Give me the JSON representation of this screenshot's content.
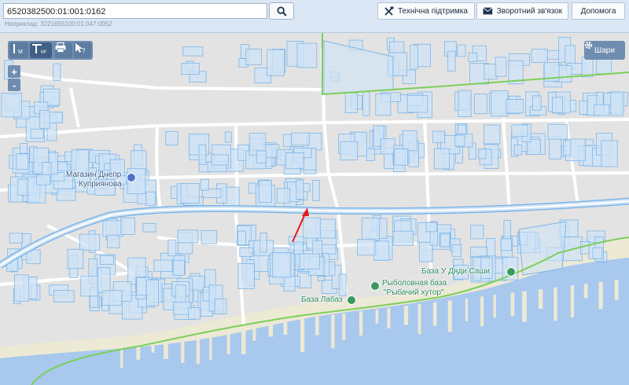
{
  "search": {
    "value": "6520382500:01:001:0162",
    "hint": "Наприклад: 3221655100:01:047:0052"
  },
  "toolbar": {
    "support_label": "Технічна підтримка",
    "feedback_label": "Зворотний зв'язок",
    "help_label": "Допомога"
  },
  "map_controls": {
    "layers_label": "Шари",
    "zoom_in": "+",
    "zoom_out": "-",
    "tool_measure_sub": "M",
    "tool_area_sub": "M²"
  },
  "map_labels": {
    "shop": "Магазин Днепр",
    "shop_line2": "Куприянова",
    "fishing_base": "Рыболовная база",
    "fishing_base_line2": "\"Рыбачий хутор\"",
    "base_uncle": "База У Дяди Саши",
    "base_labaz": "База Лабаз"
  },
  "colors": {
    "land": "#e3e3e3",
    "road": "#ffffff",
    "parcel_fill": "#cfe3f5",
    "parcel_stroke": "#7fb6e6",
    "water": "#a8c8ee",
    "beach": "#ece9d4",
    "boundary": "#7ccf5a",
    "arrow": "#e21b1b",
    "poi": "#3a9a5b"
  }
}
